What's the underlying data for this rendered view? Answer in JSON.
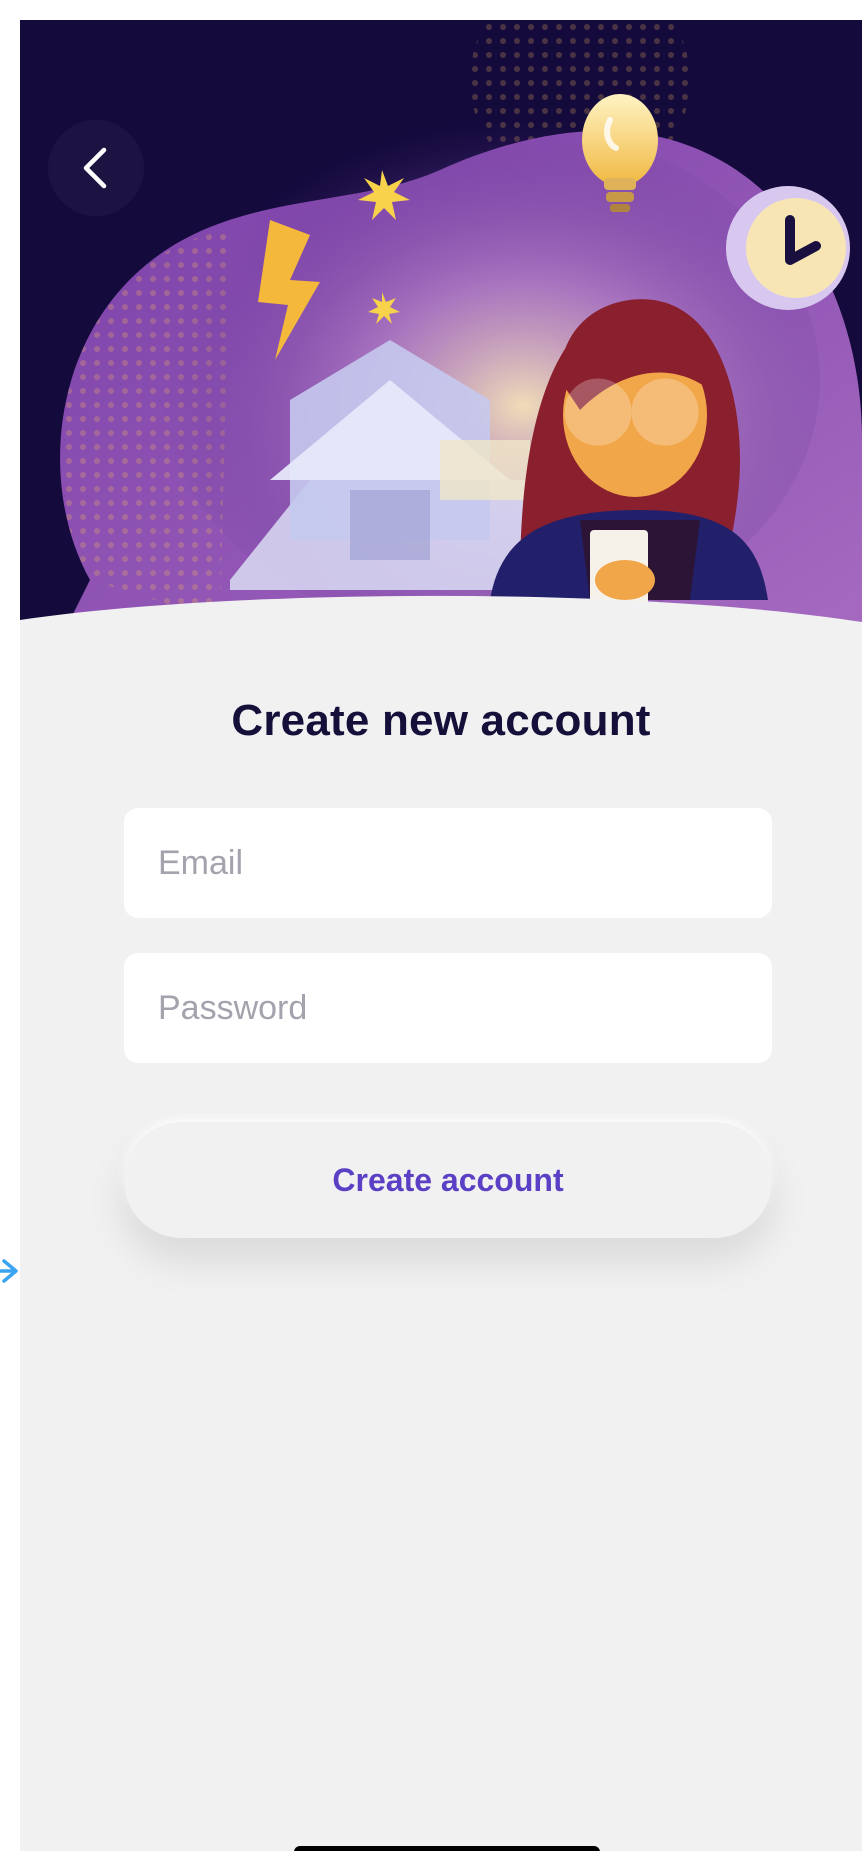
{
  "header": {
    "back_icon": "chevron-left-icon"
  },
  "form": {
    "title": "Create new account",
    "email_placeholder": "Email",
    "email_value": "",
    "password_placeholder": "Password",
    "password_value": "",
    "submit_label": "Create account"
  },
  "colors": {
    "background": "#f1f1f1",
    "hero_dark": "#140a3c",
    "blob_purple": "#6a3a9e",
    "title_text": "#14103a",
    "accent_text": "#5b3fc4",
    "placeholder_text": "#a4a2ad"
  }
}
